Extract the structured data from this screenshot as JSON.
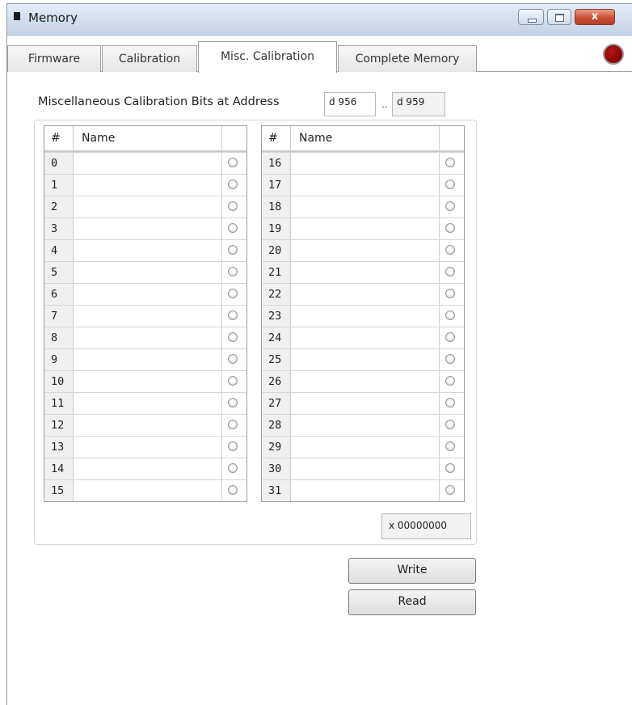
{
  "window": {
    "title": "Memory",
    "close_glyph": "x",
    "icons": {
      "app": "app-square-icon",
      "minimize": "minimize-icon",
      "maximize": "maximize-icon",
      "close": "close-icon"
    }
  },
  "tabs": [
    {
      "label": "Firmware",
      "active": false
    },
    {
      "label": "Calibration",
      "active": false
    },
    {
      "label": "Misc. Calibration",
      "active": true
    },
    {
      "label": "Complete Memory",
      "active": false
    }
  ],
  "status_indicator": {
    "color": "#8b0000"
  },
  "address": {
    "label": "Miscellaneous Calibration Bits at Address",
    "start": "d 956",
    "separator": "..",
    "end": "d 959"
  },
  "grid": {
    "headers": {
      "num": "#",
      "name": "Name"
    }
  },
  "left_bits": [
    {
      "num": "0",
      "name": ""
    },
    {
      "num": "1",
      "name": ""
    },
    {
      "num": "2",
      "name": ""
    },
    {
      "num": "3",
      "name": ""
    },
    {
      "num": "4",
      "name": ""
    },
    {
      "num": "5",
      "name": ""
    },
    {
      "num": "6",
      "name": ""
    },
    {
      "num": "7",
      "name": ""
    },
    {
      "num": "8",
      "name": ""
    },
    {
      "num": "9",
      "name": ""
    },
    {
      "num": "10",
      "name": ""
    },
    {
      "num": "11",
      "name": ""
    },
    {
      "num": "12",
      "name": ""
    },
    {
      "num": "13",
      "name": ""
    },
    {
      "num": "14",
      "name": ""
    },
    {
      "num": "15",
      "name": ""
    }
  ],
  "right_bits": [
    {
      "num": "16",
      "name": ""
    },
    {
      "num": "17",
      "name": ""
    },
    {
      "num": "18",
      "name": ""
    },
    {
      "num": "19",
      "name": ""
    },
    {
      "num": "20",
      "name": ""
    },
    {
      "num": "21",
      "name": ""
    },
    {
      "num": "22",
      "name": ""
    },
    {
      "num": "23",
      "name": ""
    },
    {
      "num": "24",
      "name": ""
    },
    {
      "num": "25",
      "name": ""
    },
    {
      "num": "26",
      "name": ""
    },
    {
      "num": "27",
      "name": ""
    },
    {
      "num": "28",
      "name": ""
    },
    {
      "num": "29",
      "name": ""
    },
    {
      "num": "30",
      "name": ""
    },
    {
      "num": "31",
      "name": ""
    }
  ],
  "value": "x 00000000",
  "buttons": {
    "write": "Write",
    "read": "Read"
  }
}
